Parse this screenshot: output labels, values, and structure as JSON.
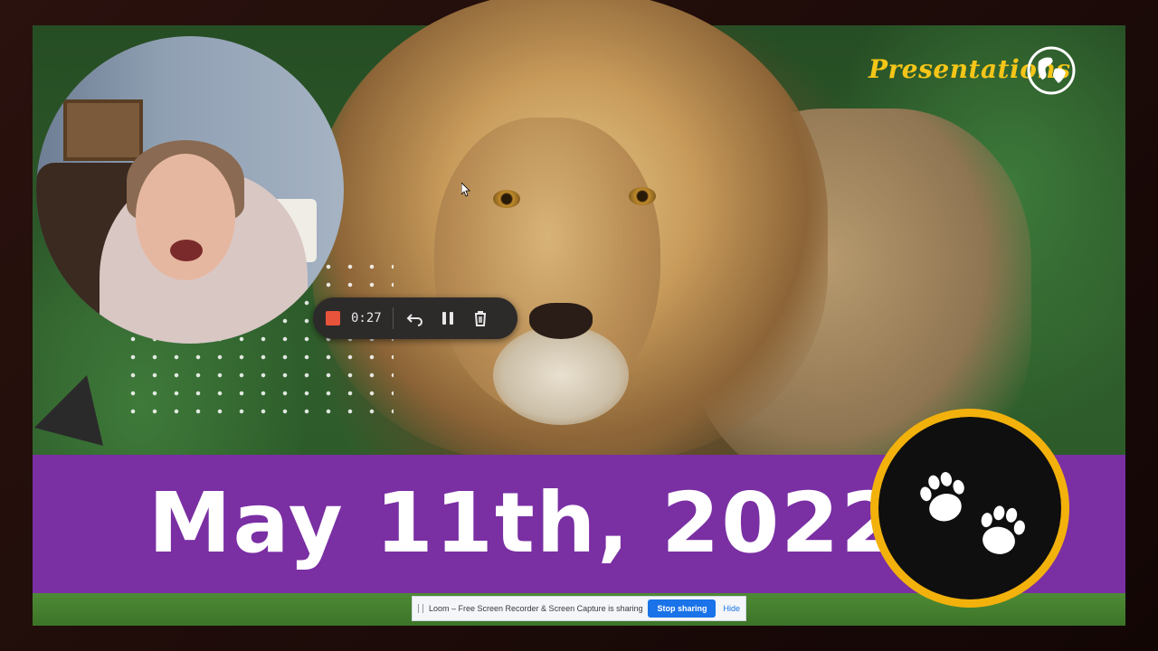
{
  "brand": {
    "name": "Presentations",
    "icon": "globe-icon"
  },
  "banner": {
    "date": "May 11th, 2022",
    "color": "#7a2fa3"
  },
  "badge": {
    "icon": "paw-prints-icon",
    "ring_color": "#f3b10c"
  },
  "recorder": {
    "time": "0:27",
    "stop_icon": "stop-icon",
    "undo_icon": "undo-icon",
    "pause_icon": "pause-icon",
    "delete_icon": "trash-icon",
    "stop_color": "#e8533b"
  },
  "share_bar": {
    "message": "Loom – Free Screen Recorder & Screen Capture is sharing your screen.",
    "stop_label": "Stop sharing",
    "hide_label": "Hide"
  }
}
